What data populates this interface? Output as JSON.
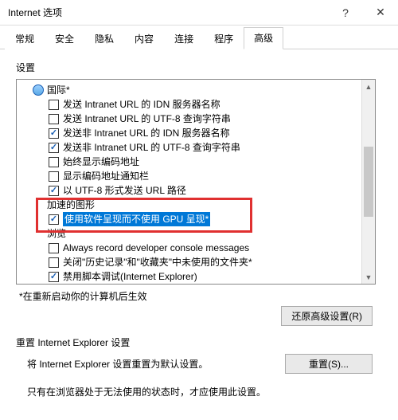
{
  "title": "Internet 选项",
  "tabs": [
    "常规",
    "安全",
    "隐私",
    "内容",
    "连接",
    "程序",
    "高级"
  ],
  "active_tab": "高级",
  "section_label": "设置",
  "tree": {
    "group_intl": "国际*",
    "items_intl": [
      {
        "checked": false,
        "label": "发送 Intranet URL 的 IDN 服务器名称"
      },
      {
        "checked": false,
        "label": "发送 Intranet URL 的 UTF-8 查询字符串"
      },
      {
        "checked": true,
        "label": "发送非 Intranet URL 的 IDN 服务器名称"
      },
      {
        "checked": true,
        "label": "发送非 Intranet URL 的 UTF-8 查询字符串"
      },
      {
        "checked": false,
        "label": "始终显示编码地址"
      },
      {
        "checked": false,
        "label": "显示编码地址通知栏"
      },
      {
        "checked": true,
        "label": "以 UTF-8 形式发送 URL 路径"
      }
    ],
    "group_accel": "加速的图形",
    "item_accel": {
      "checked": true,
      "label": "使用软件呈现而不使用 GPU 呈现*"
    },
    "group_browse": "浏览",
    "items_browse": [
      {
        "checked": false,
        "label": "Always record developer console messages"
      },
      {
        "checked": false,
        "label": "关闭\"历史记录\"和\"收藏夹\"中未使用的文件夹*"
      },
      {
        "checked": true,
        "label": "禁用脚本调试(Internet Explorer)"
      }
    ]
  },
  "footnote": "*在重新启动你的计算机后生效",
  "restore_btn": "还原高级设置(R)",
  "reset_heading": "重置 Internet Explorer 设置",
  "reset_desc": "将 Internet Explorer 设置重置为默认设置。",
  "reset_btn": "重置(S)...",
  "bottom_note": "只有在浏览器处于无法使用的状态时，才应使用此设置。"
}
